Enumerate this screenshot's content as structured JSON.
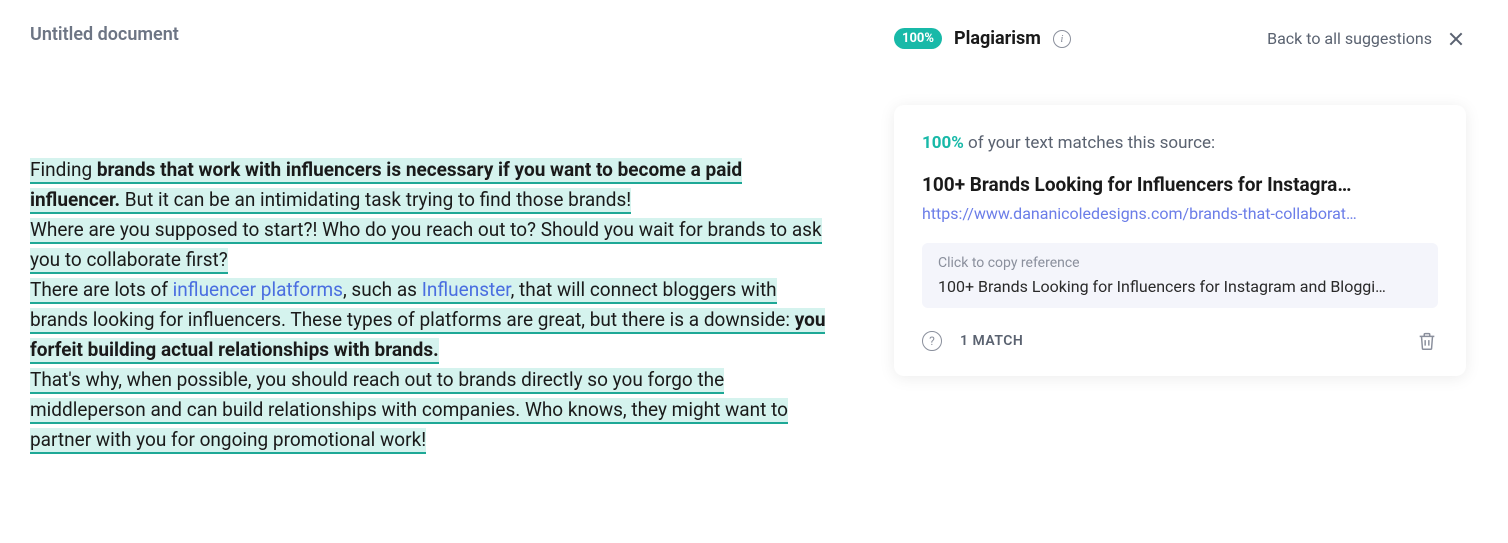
{
  "document": {
    "title": "Untitled document",
    "content": {
      "p1a": "Finding ",
      "p1b": "brands that work with influencers is necessary if you want to become a paid influencer.",
      "p1c": " But it can be an intimidating task trying to find those brands!",
      "p2": "Where are you supposed to start?! Who do you reach out to? Should you wait for brands to ask you to collaborate first?",
      "p3a": "There are lots of ",
      "p3link1": "influencer platforms",
      "p3b": ", such as ",
      "p3link2": "Influenster",
      "p3c": ", that will connect bloggers with brands looking for influencers. These types of platforms are great, but there is a downside: ",
      "p3d": "you forfeit building actual relationships with brands.",
      "p4": "That's why, when possible, you should reach out to brands directly so you forgo the middleperson and can build relationships with companies. Who knows, they might want to partner with you for ongoing promotional work!"
    }
  },
  "sidebar": {
    "badge": "100%",
    "label": "Plagiarism",
    "back": "Back to all suggestions"
  },
  "card": {
    "match_pct": "100%",
    "match_text": " of your text matches this source:",
    "source_title": "100+ Brands Looking for Influencers for Instagra…",
    "source_url": "https://www.dananicoledesigns.com/brands-that-collaborat…",
    "ref_hint": "Click to copy reference",
    "ref_text": "100+ Brands Looking for Influencers for Instagram and Bloggi…",
    "match_count": "1 MATCH"
  }
}
